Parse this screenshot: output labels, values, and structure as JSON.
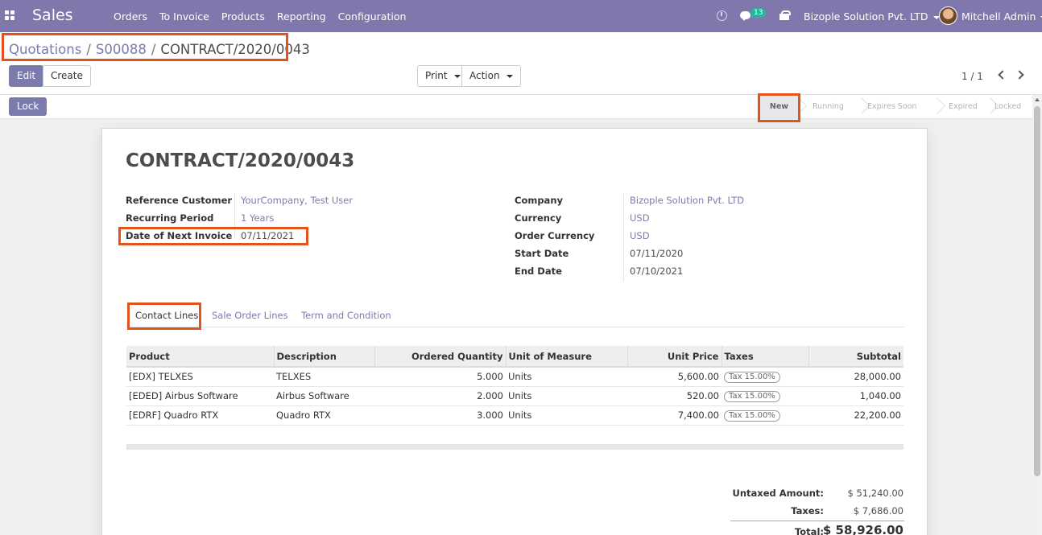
{
  "navbar": {
    "app_name": "Sales",
    "menu": [
      "Orders",
      "To Invoice",
      "Products",
      "Reporting",
      "Configuration"
    ],
    "message_count": "13",
    "company": "Bizople Solution Pvt. LTD",
    "user": "Mitchell Admin",
    "color": "#8077ad"
  },
  "breadcrumb": {
    "items": [
      "Quotations",
      "S00088"
    ],
    "current": "CONTRACT/2020/0043",
    "separator": "/"
  },
  "toolbar": {
    "edit_label": "Edit",
    "create_label": "Create",
    "print_label": "Print",
    "action_label": "Action",
    "pager": "1 / 1",
    "lock_label": "Lock"
  },
  "statusbar": {
    "steps": [
      "New",
      "Running",
      "Expires Soon",
      "Expired",
      "Locked"
    ],
    "active": "New"
  },
  "record": {
    "title": "CONTRACT/2020/0043",
    "left_fields": [
      {
        "label": "Reference Customer",
        "value": "YourCompany, Test User",
        "link": true
      },
      {
        "label": "Recurring Period",
        "value": "1 Years",
        "link": true
      },
      {
        "label": "Date of Next Invoice",
        "value": "07/11/2021",
        "link": false
      }
    ],
    "right_fields": [
      {
        "label": "Company",
        "value": "Bizople Solution Pvt. LTD",
        "link": true
      },
      {
        "label": "Currency",
        "value": "USD",
        "link": true
      },
      {
        "label": "Order Currency",
        "value": "USD",
        "link": true
      },
      {
        "label": "Start Date",
        "value": "07/11/2020",
        "link": false
      },
      {
        "label": "End Date",
        "value": "07/10/2021",
        "link": false
      }
    ]
  },
  "tabs": [
    "Contact Lines",
    "Sale Order Lines",
    "Term and Condition"
  ],
  "lines": {
    "columns": [
      "Product",
      "Description",
      "Ordered Quantity",
      "Unit of Measure",
      "Unit Price",
      "Taxes",
      "Subtotal"
    ],
    "rows": [
      {
        "product": "[EDX] TELXES",
        "description": "TELXES",
        "qty": "5.000",
        "uom": "Units",
        "price": "5,600.00",
        "tax": "Tax 15.00%",
        "subtotal": "28,000.00"
      },
      {
        "product": "[EDED] Airbus Software",
        "description": "Airbus Software",
        "qty": "2.000",
        "uom": "Units",
        "price": "520.00",
        "tax": "Tax 15.00%",
        "subtotal": "1,040.00"
      },
      {
        "product": "[EDRF] Quadro RTX",
        "description": "Quadro RTX",
        "qty": "3.000",
        "uom": "Units",
        "price": "7,400.00",
        "tax": "Tax 15.00%",
        "subtotal": "22,200.00"
      }
    ]
  },
  "totals": {
    "untaxed_label": "Untaxed Amount:",
    "untaxed_value": "$ 51,240.00",
    "taxes_label": "Taxes:",
    "taxes_value": "$ 7,686.00",
    "total_label": "Total:",
    "total_value": "$ 58,926.00"
  },
  "colors": {
    "accent": "#7c7bad",
    "highlight": "#e4531c"
  }
}
